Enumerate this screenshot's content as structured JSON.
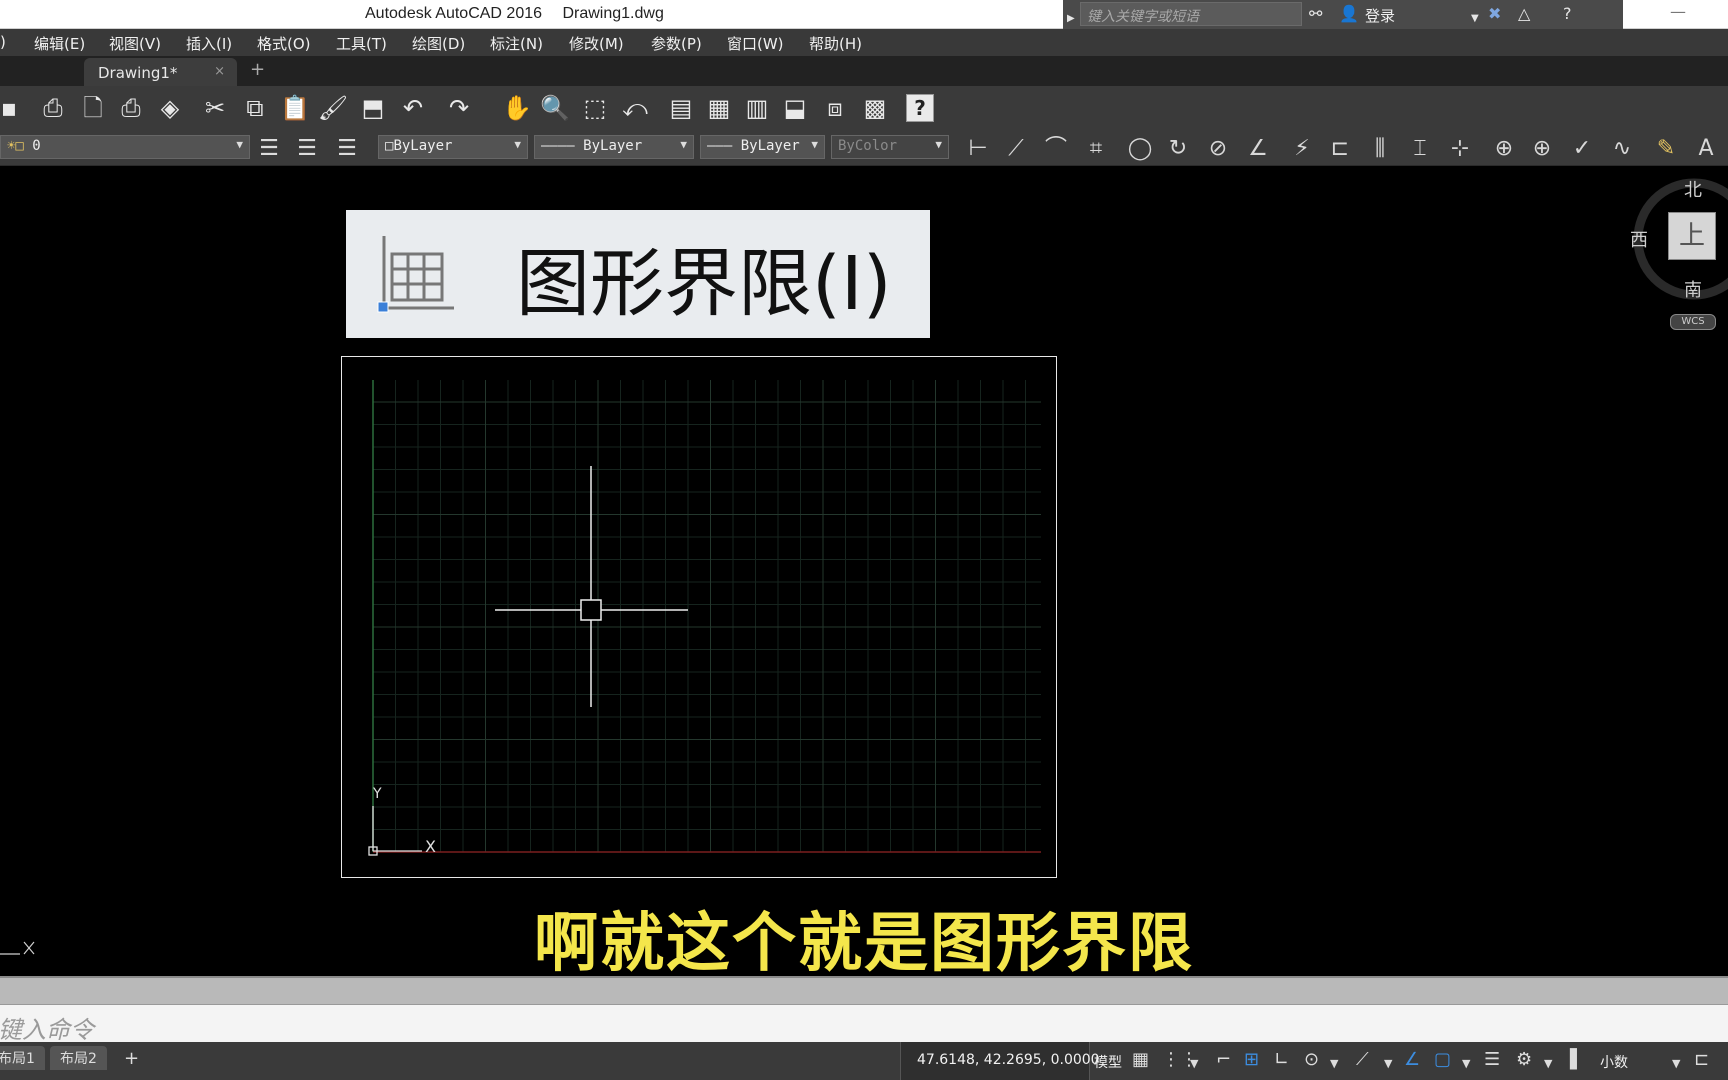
{
  "window": {
    "app_title": "Autodesk AutoCAD 2016",
    "file_name": "Drawing1.dwg",
    "search_placeholder": "键入关键字或短语",
    "login_label": "登录"
  },
  "menu": [
    {
      "label": ")"
    },
    {
      "label": "编辑(E)"
    },
    {
      "label": "视图(V)"
    },
    {
      "label": "插入(I)"
    },
    {
      "label": "格式(O)"
    },
    {
      "label": "工具(T)"
    },
    {
      "label": "绘图(D)"
    },
    {
      "label": "标注(N)"
    },
    {
      "label": "修改(M)"
    },
    {
      "label": "参数(P)"
    },
    {
      "label": "窗口(W)"
    },
    {
      "label": "帮助(H)"
    }
  ],
  "tabs": {
    "active_label": "Drawing1*",
    "close_glyph": "×",
    "add_glyph": "+"
  },
  "toolbar": {
    "help_label": "?"
  },
  "properties": {
    "layer_value": "0",
    "color_value": "ByLayer",
    "linetype_value": "ByLayer",
    "lineweight_value": "ByLayer",
    "plotstyle_value": "ByColor"
  },
  "callout": {
    "text": "图形界限(I)"
  },
  "drawing": {
    "axis_y": "Y",
    "axis_x": "X"
  },
  "viewcube": {
    "north": "北",
    "west": "西",
    "south": "南",
    "top": "上",
    "wcs": "WCS"
  },
  "subtitle": "啊就这个就是图形界限",
  "command": {
    "placeholder": "键入命令"
  },
  "status": {
    "layout_tabs": [
      "布局1",
      "布局2"
    ],
    "coordinates": "47.6148, 42.2695, 0.0000",
    "model_label": "模型",
    "units_label": "小数"
  }
}
